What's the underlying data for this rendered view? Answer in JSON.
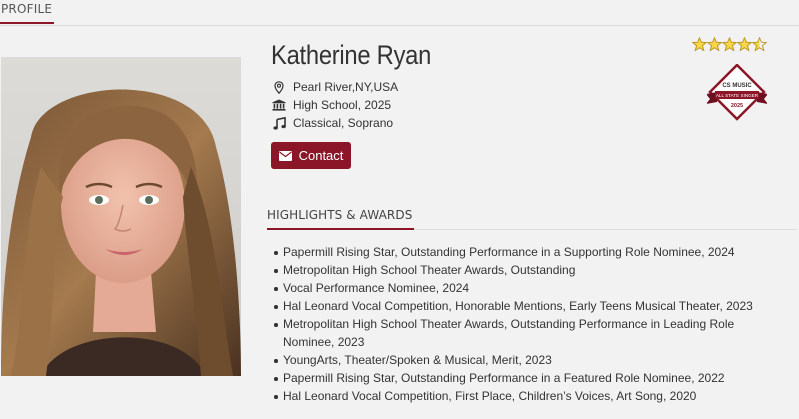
{
  "header": {
    "tab_label": "PROFILE"
  },
  "profile": {
    "name": "Katherine Ryan",
    "location": "Pearl River,NY,USA",
    "school": "High School, 2025",
    "genre": "Classical, Soprano",
    "contact_label": "Contact",
    "rating": 4.5,
    "rating_max": 5
  },
  "badge": {
    "line1": "CS MUSIC",
    "line2": "ALL STATE SINGER",
    "year": "2025"
  },
  "highlights": {
    "title": "HIGHLIGHTS & AWARDS",
    "items": [
      "Papermill Rising Star, Outstanding Performance in a Supporting Role Nominee, 2024",
      "Metropolitan High School Theater Awards, Outstanding",
      "Vocal Performance Nominee, 2024",
      "Hal Leonard Vocal Competition, Honorable Mentions, Early Teens Musical Theater, 2023",
      "Metropolitan High School Theater Awards, Outstanding Performance in Leading Role Nominee, 2023",
      "YoungArts, Theater/Spoken & Musical, Merit, 2023",
      "Papermill Rising Star, Outstanding Performance in a Featured Role Nominee, 2022",
      "Hal Leonard Vocal Competition, First Place, Children’s Voices, Art Song, 2020"
    ]
  },
  "icons": {
    "location": "map-pin-icon",
    "school": "institution-icon",
    "genre": "music-note-icon",
    "contact": "envelope-icon",
    "rating": "star-icon"
  },
  "colors": {
    "accent": "#8a1628",
    "star_fill": "#f6d64a",
    "star_stroke": "#b8901a"
  }
}
